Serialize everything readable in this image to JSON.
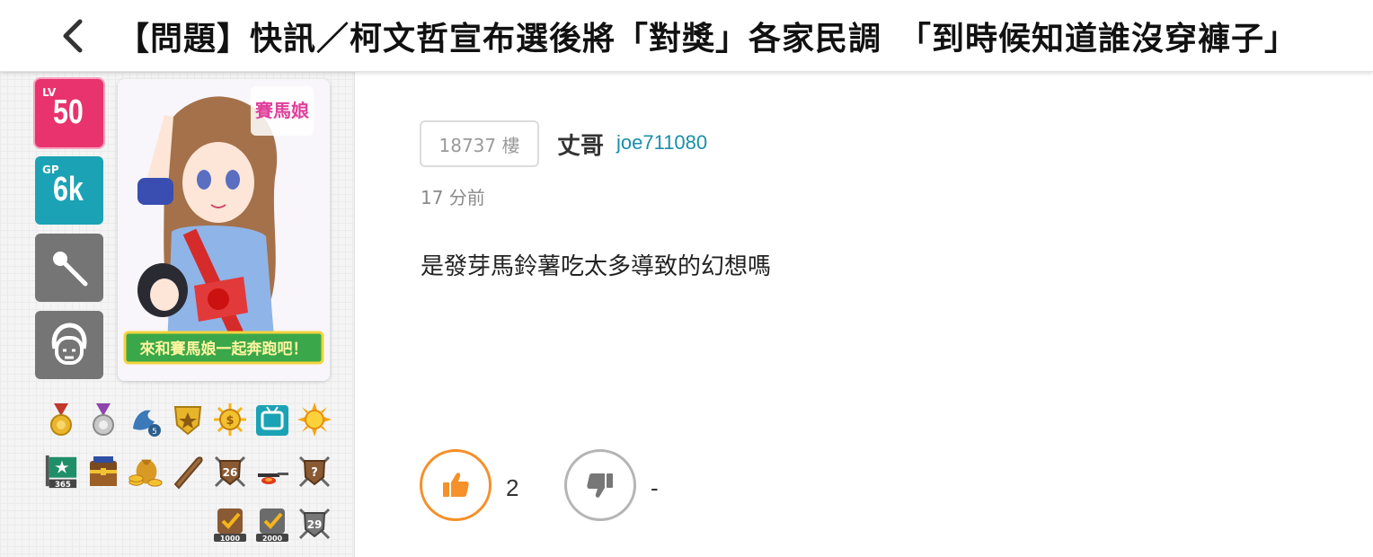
{
  "header": {
    "back_icon": "chevron-left-icon",
    "title": "【問題】快訊／柯文哲宣布選後將「對獎」各家民調　「到時候知道誰沒穿褲子」"
  },
  "sidebar": {
    "level_label": "LV",
    "level_value": "50",
    "gp_label": "GP",
    "gp_value": "6k",
    "tool_icons": [
      "magic-wand-icon",
      "face-icon"
    ],
    "avatar_banner": "來和賽馬娘一起奔跑吧！",
    "badges_row1": [
      "gold-medal-icon",
      "silver-medal-icon",
      "dragon-badge-icon",
      "star-shield-icon",
      "coin-badge-icon",
      "tv-badge-icon",
      "sun-badge-icon"
    ],
    "badges_row2": [
      "flag-365-icon",
      "treasure-chest-icon",
      "gold-coins-icon",
      "bat-icon",
      "shield-26-icon",
      "pan-icon",
      "shield-question-icon"
    ],
    "badges_row3": [
      "check-1000-icon",
      "check-2000-icon",
      "shield-29-icon"
    ],
    "badge_texts": {
      "flag": "365",
      "shield26": "26",
      "check1000": "1000",
      "check2000": "2000",
      "shield29": "29",
      "question": "?"
    },
    "colors": {
      "level": "#e8336e",
      "gp": "#1ba3b5",
      "tool": "#757575"
    }
  },
  "post": {
    "floor": "18737 樓",
    "username": "丈哥",
    "user_id": "joe711080",
    "time": "17 分前",
    "content": "是發芽馬鈴薯吃太多導致的幻想嗎",
    "upvotes": "2",
    "downvotes": "-",
    "colors": {
      "upvote": "#f5902a",
      "downvote": "#b5b5b5",
      "user_id": "#1a8fa8"
    }
  }
}
